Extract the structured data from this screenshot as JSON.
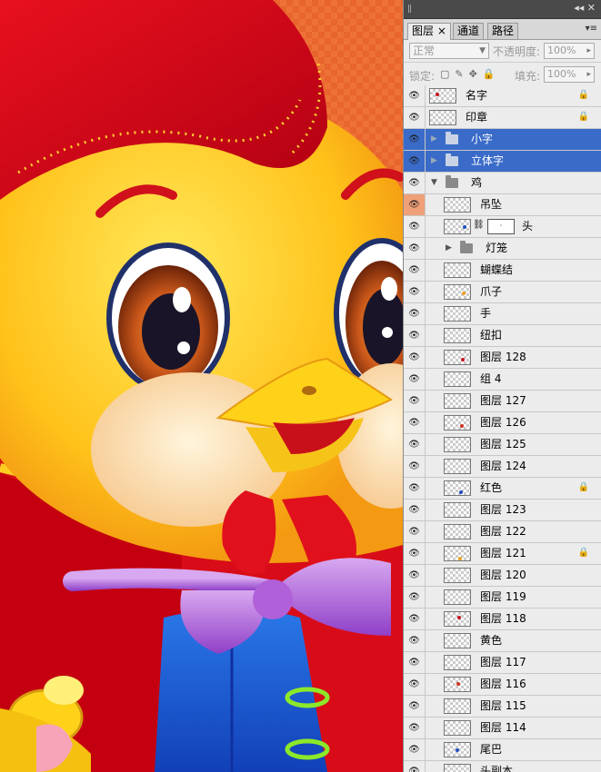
{
  "tabs": [
    "图层",
    "通道",
    "路径"
  ],
  "tab_close": "×",
  "blend_mode": "正常",
  "opacity_label": "不透明度:",
  "opacity_value": "100%",
  "lock_label": "锁定:",
  "fill_label": "填充:",
  "fill_value": "100%",
  "layers": [
    {
      "name": "名字",
      "kind": "layer",
      "locked": true
    },
    {
      "name": "印章",
      "kind": "layer",
      "locked": true
    },
    {
      "name": "小字",
      "kind": "group",
      "selected": true
    },
    {
      "name": "立体字",
      "kind": "group",
      "selected": true
    },
    {
      "name": "鸡",
      "kind": "group-open"
    },
    {
      "name": "吊坠",
      "kind": "child",
      "eye_highlight": true
    },
    {
      "name": "头",
      "kind": "child-mask"
    },
    {
      "name": "灯笼",
      "kind": "child-group"
    },
    {
      "name": "蝴蝶结",
      "kind": "child"
    },
    {
      "name": "爪子",
      "kind": "child"
    },
    {
      "name": "手",
      "kind": "child"
    },
    {
      "name": "纽扣",
      "kind": "child"
    },
    {
      "name": "图层 128",
      "kind": "child"
    },
    {
      "name": "组 4",
      "kind": "child"
    },
    {
      "name": "图层 127",
      "kind": "child"
    },
    {
      "name": "图层 126",
      "kind": "child"
    },
    {
      "name": "图层 125",
      "kind": "child"
    },
    {
      "name": "图层 124",
      "kind": "child"
    },
    {
      "name": "红色",
      "kind": "child",
      "locked": true
    },
    {
      "name": "图层 123",
      "kind": "child"
    },
    {
      "name": "图层 122",
      "kind": "child"
    },
    {
      "name": "图层 121",
      "kind": "child",
      "locked": true
    },
    {
      "name": "图层 120",
      "kind": "child"
    },
    {
      "name": "图层 119",
      "kind": "child"
    },
    {
      "name": "图层 118",
      "kind": "child"
    },
    {
      "name": "黄色",
      "kind": "child"
    },
    {
      "name": "图层 117",
      "kind": "child"
    },
    {
      "name": "图层 116",
      "kind": "child"
    },
    {
      "name": "图层 115",
      "kind": "child"
    },
    {
      "name": "图层 114",
      "kind": "child"
    },
    {
      "name": "尾巴",
      "kind": "child"
    },
    {
      "name": "头副本",
      "kind": "child"
    }
  ],
  "colors": {
    "selection": "#3a6bc8",
    "eye_highlight": "#f0a078",
    "canvas_bg": "#e8622c"
  }
}
